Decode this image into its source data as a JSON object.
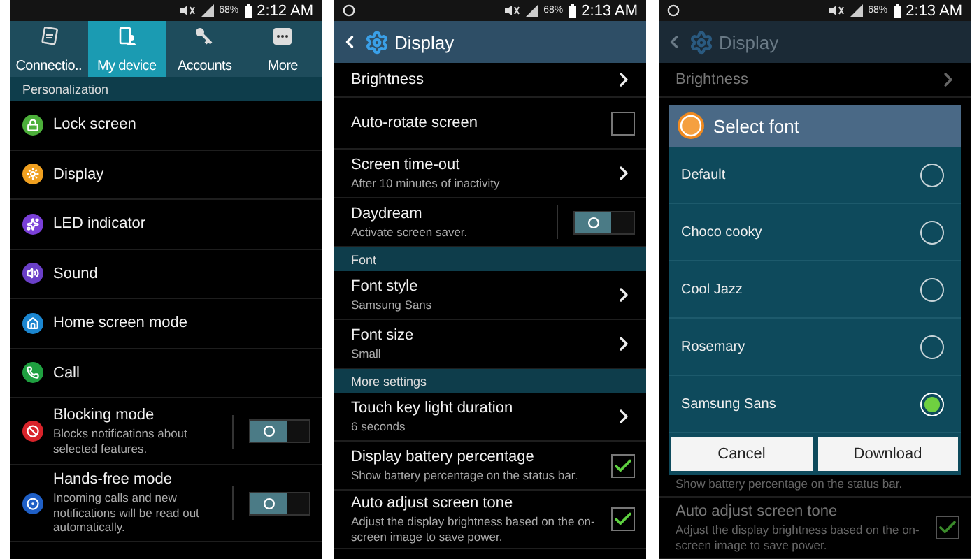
{
  "my_device_screen": {
    "status_bar": {
      "notification_icon": false,
      "battery": "68%",
      "time": "2:12 AM"
    },
    "tabs": [
      {
        "label": "Connectio..",
        "selected": false
      },
      {
        "label": "My device",
        "selected": true
      },
      {
        "label": "Accounts",
        "selected": false
      },
      {
        "label": "More",
        "selected": false
      }
    ],
    "section": "Personalization",
    "items": [
      {
        "kind": "link",
        "title": "Lock screen",
        "color": "#4caf3a"
      },
      {
        "kind": "link",
        "title": "Display",
        "color": "#f0a020"
      },
      {
        "kind": "link",
        "title": "LED indicator",
        "color": "#7a3fd8"
      },
      {
        "kind": "link",
        "title": "Sound",
        "color": "#6a3fc8"
      },
      {
        "kind": "link",
        "title": "Home screen mode",
        "color": "#1b86d0"
      },
      {
        "kind": "link",
        "title": "Call",
        "color": "#1fa040"
      },
      {
        "kind": "toggle",
        "title": "Blocking mode",
        "subtitle": "Blocks notifications about selected features.",
        "on": false,
        "color": "#d8232a"
      },
      {
        "kind": "toggle",
        "title": "Hands-free mode",
        "subtitle": "Incoming calls and new notifications will be read out automatically.",
        "on": false,
        "color": "#1f5fc6"
      }
    ]
  },
  "display_screen": {
    "status_bar": {
      "notification_icon": true,
      "battery": "68%",
      "time": "2:13 AM"
    },
    "header": {
      "title": "Display"
    },
    "rows": [
      {
        "kind": "link",
        "title": "Brightness"
      },
      {
        "kind": "checkbox",
        "title": "Auto-rotate screen",
        "checked": false
      },
      {
        "kind": "link",
        "title": "Screen time-out",
        "subtitle": "After 10 minutes of inactivity"
      },
      {
        "kind": "toggle",
        "title": "Daydream",
        "subtitle": "Activate screen saver.",
        "on": false
      },
      {
        "kind": "section",
        "title": "Font"
      },
      {
        "kind": "link",
        "title": "Font style",
        "subtitle": "Samsung Sans"
      },
      {
        "kind": "link",
        "title": "Font size",
        "subtitle": "Small"
      },
      {
        "kind": "section",
        "title": "More settings"
      },
      {
        "kind": "link",
        "title": "Touch key light duration",
        "subtitle": "6 seconds"
      },
      {
        "kind": "checkbox",
        "title": "Display battery percentage",
        "subtitle": "Show battery percentage on the status bar.",
        "checked": true
      },
      {
        "kind": "checkbox",
        "title": "Auto adjust screen tone",
        "subtitle": "Adjust the display brightness based on the on-screen image to save power.",
        "checked": true
      }
    ]
  },
  "font_dialog_screen": {
    "status_bar": {
      "notification_icon": true,
      "battery": "68%",
      "time": "2:13 AM"
    },
    "header": {
      "title": "Display"
    },
    "top_rows": [
      {
        "kind": "link",
        "title": "Brightness"
      }
    ],
    "bottom_rows": [
      {
        "kind": "note",
        "subtitle": "Show battery percentage on the status bar."
      },
      {
        "kind": "checkbox",
        "title": "Auto adjust screen tone",
        "subtitle": "Adjust the display brightness based on the on-screen image to save power.",
        "checked": true
      }
    ],
    "dialog": {
      "title": "Select font",
      "options": [
        {
          "label": "Default",
          "selected": false
        },
        {
          "label": "Choco cooky",
          "selected": false
        },
        {
          "label": "Cool Jazz",
          "selected": false
        },
        {
          "label": "Rosemary",
          "selected": false
        },
        {
          "label": "Samsung Sans",
          "selected": true
        }
      ],
      "buttons": [
        "Cancel",
        "Download"
      ]
    }
  }
}
